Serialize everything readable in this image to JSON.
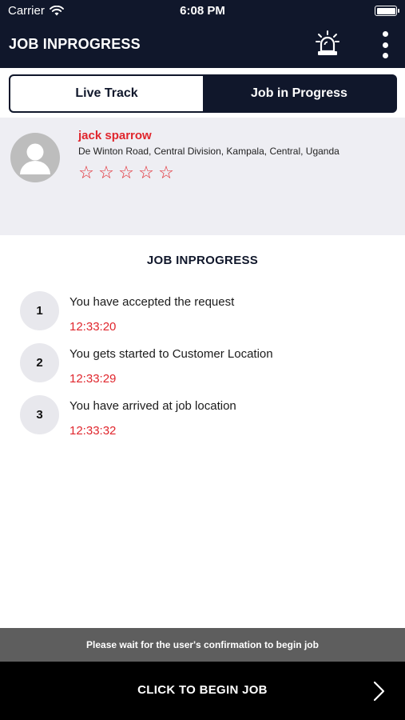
{
  "status_bar": {
    "carrier": "Carrier",
    "time": "6:08 PM",
    "battery_level": 1.0
  },
  "header": {
    "title": "JOB INPROGRESS",
    "alarm_icon": "siren-icon",
    "menu_icon": "more-vertical-icon"
  },
  "tabs": [
    {
      "label": "Live Track",
      "selected": true
    },
    {
      "label": "Job in Progress",
      "selected": false
    }
  ],
  "customer": {
    "name": "jack sparrow",
    "address": "De Winton Road, Central Division, Kampala, Central, Uganda",
    "rating": 0,
    "rating_max": 5,
    "star_glyph": "☆"
  },
  "section_title": "JOB INPROGRESS",
  "steps": [
    {
      "number": "1",
      "text": "You have accepted the request",
      "time": "12:33:20"
    },
    {
      "number": "2",
      "text": "You gets started to Customer Location",
      "time": "12:33:29"
    },
    {
      "number": "3",
      "text": "You have arrived at job location",
      "time": "12:33:32"
    }
  ],
  "notice": "Please wait for the user's confirmation  to begin job",
  "begin_button": {
    "label": "CLICK TO BEGIN JOB",
    "icon": "chevron-right-icon"
  },
  "colors": {
    "navy": "#10172b",
    "accent_red": "#e0262d",
    "notice_gray": "#5e5e5e",
    "card_bg": "#eeeef3"
  }
}
